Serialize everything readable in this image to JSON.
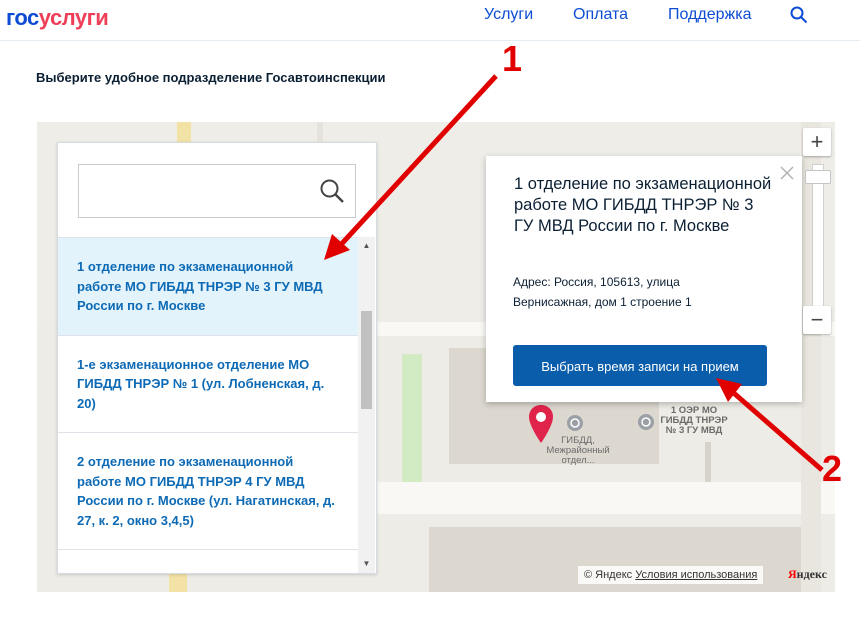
{
  "header": {
    "logo_part1": "гос",
    "logo_part2": "услуги",
    "nav": [
      "Услуги",
      "Оплата",
      "Поддержка"
    ]
  },
  "page": {
    "title": "Выберите удобное подразделение Госавтоинспекции"
  },
  "sidebar": {
    "items": [
      {
        "text": "1 отделение по экзаменационной работе МО ГИБДД ТНРЭР № 3 ГУ МВД России по г. Москве",
        "selected": true
      },
      {
        "text": "1-е экзаменационное отделение МО ГИБДД ТНРЭР № 1 (ул. Лобненская, д. 20)",
        "selected": false
      },
      {
        "text": "2 отделение по экзаменационной работе МО ГИБДД ТНРЭР 4 ГУ МВД России по г. Москве (ул. Нагатинская, д. 27, к. 2, окно 3,4,5)",
        "selected": false
      }
    ]
  },
  "popup": {
    "title": "1 отделение по экзаменационной работе МО ГИБДД ТНРЭР № 3 ГУ МВД России по г. Москве",
    "address": "Адрес: Россия, 105613, улица Вернисажная, дом 1 строение 1",
    "button": "Выбрать время записи на прием"
  },
  "map": {
    "label_gibdd": "ГИБДД, Межрайонный отдел...",
    "label_oer": "1 ОЭР МО ГИБДД ТНРЭР № 3 ГУ МВД",
    "copyright_prefix": "© Яндекс",
    "copyright_terms": "Условия использования",
    "logo_y": "Я",
    "logo_rest": "ндекс"
  },
  "annotations": {
    "one": "1",
    "two": "2"
  },
  "colors": {
    "brand_blue": "#0d4cd3",
    "brand_red": "#ee3f58",
    "button_blue": "#0a5daa",
    "annotation_red": "#e00000"
  }
}
